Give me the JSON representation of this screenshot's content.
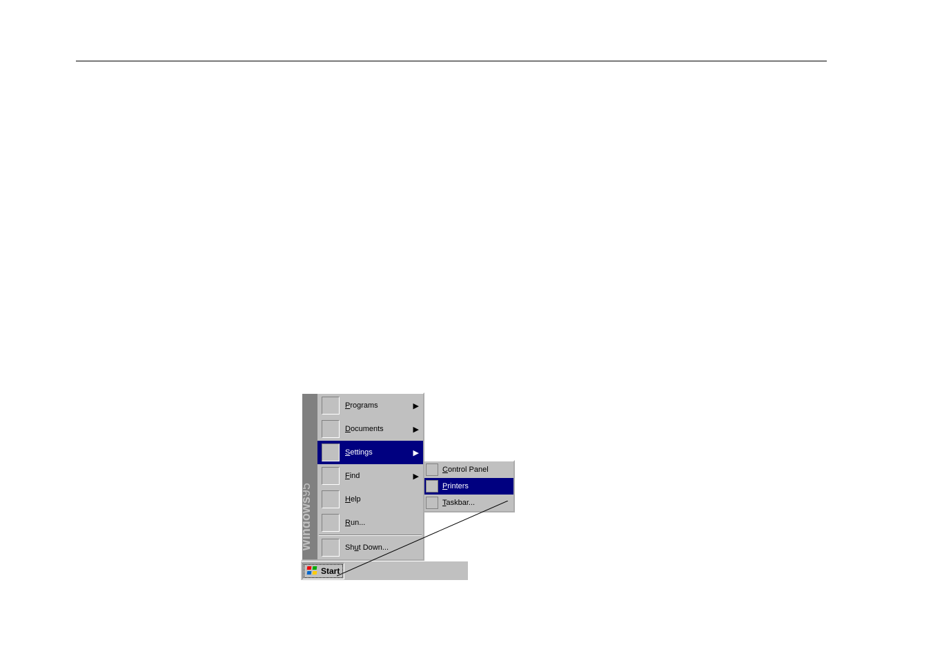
{
  "os_brand": "Windows95",
  "start_button": {
    "label": "Start"
  },
  "start_menu": [
    {
      "mnemonic": "P",
      "rest": "rograms",
      "has_submenu": true,
      "selected": false,
      "icon": "programs-icon"
    },
    {
      "mnemonic": "D",
      "rest": "ocuments",
      "has_submenu": true,
      "selected": false,
      "icon": "documents-icon"
    },
    {
      "mnemonic": "S",
      "rest": "ettings",
      "has_submenu": true,
      "selected": true,
      "icon": "settings-icon"
    },
    {
      "mnemonic": "F",
      "rest": "ind",
      "has_submenu": true,
      "selected": false,
      "icon": "find-icon"
    },
    {
      "mnemonic": "H",
      "rest": "elp",
      "has_submenu": false,
      "selected": false,
      "icon": "help-icon"
    },
    {
      "mnemonic": "R",
      "rest": "un...",
      "has_submenu": false,
      "selected": false,
      "icon": "run-icon"
    },
    {
      "separator": true
    },
    {
      "mnemonic": "",
      "rest": "Shu̲t Down...",
      "has_submenu": false,
      "selected": false,
      "icon": "shutdown-icon",
      "raw_label": "Shut Down...",
      "mnemonic_u": "u"
    }
  ],
  "shutdown": {
    "pre": "Sh",
    "mnemonic": "u",
    "post": "t Down..."
  },
  "settings_submenu": [
    {
      "mnemonic": "C",
      "rest": "ontrol Panel",
      "selected": false,
      "icon": "control-panel-icon"
    },
    {
      "mnemonic": "P",
      "rest": "rinters",
      "selected": true,
      "icon": "printers-icon"
    },
    {
      "mnemonic": "T",
      "rest": "askbar...",
      "selected": false,
      "icon": "taskbar-icon"
    }
  ],
  "glyphs": {
    "submenu_arrow": "▶"
  }
}
